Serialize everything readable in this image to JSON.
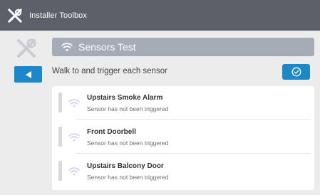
{
  "header": {
    "title": "Installer Toolbox"
  },
  "page": {
    "section_title": "Sensors Test",
    "instruction": "Walk to and trigger each sensor"
  },
  "icons": {
    "logo": "tools-cross-icon",
    "tools": "tools-cross-icon",
    "back": "triangle-left-icon",
    "confirm": "check-circle-icon",
    "sensor": "wifi-signal-icon"
  },
  "colors": {
    "titlebar": "#5d6068",
    "accent": "#1e87c8",
    "section_header": "#a5acb6",
    "sensor_icon": "#c9cdf2"
  },
  "sensors": [
    {
      "name": "Upstairs Smoke Alarm",
      "status": "Sensor has not been triggered"
    },
    {
      "name": "Front Doorbell",
      "status": "Sensor has not been triggered"
    },
    {
      "name": "Upstairs Balcony Door",
      "status": "Sensor has not been triggered"
    }
  ]
}
